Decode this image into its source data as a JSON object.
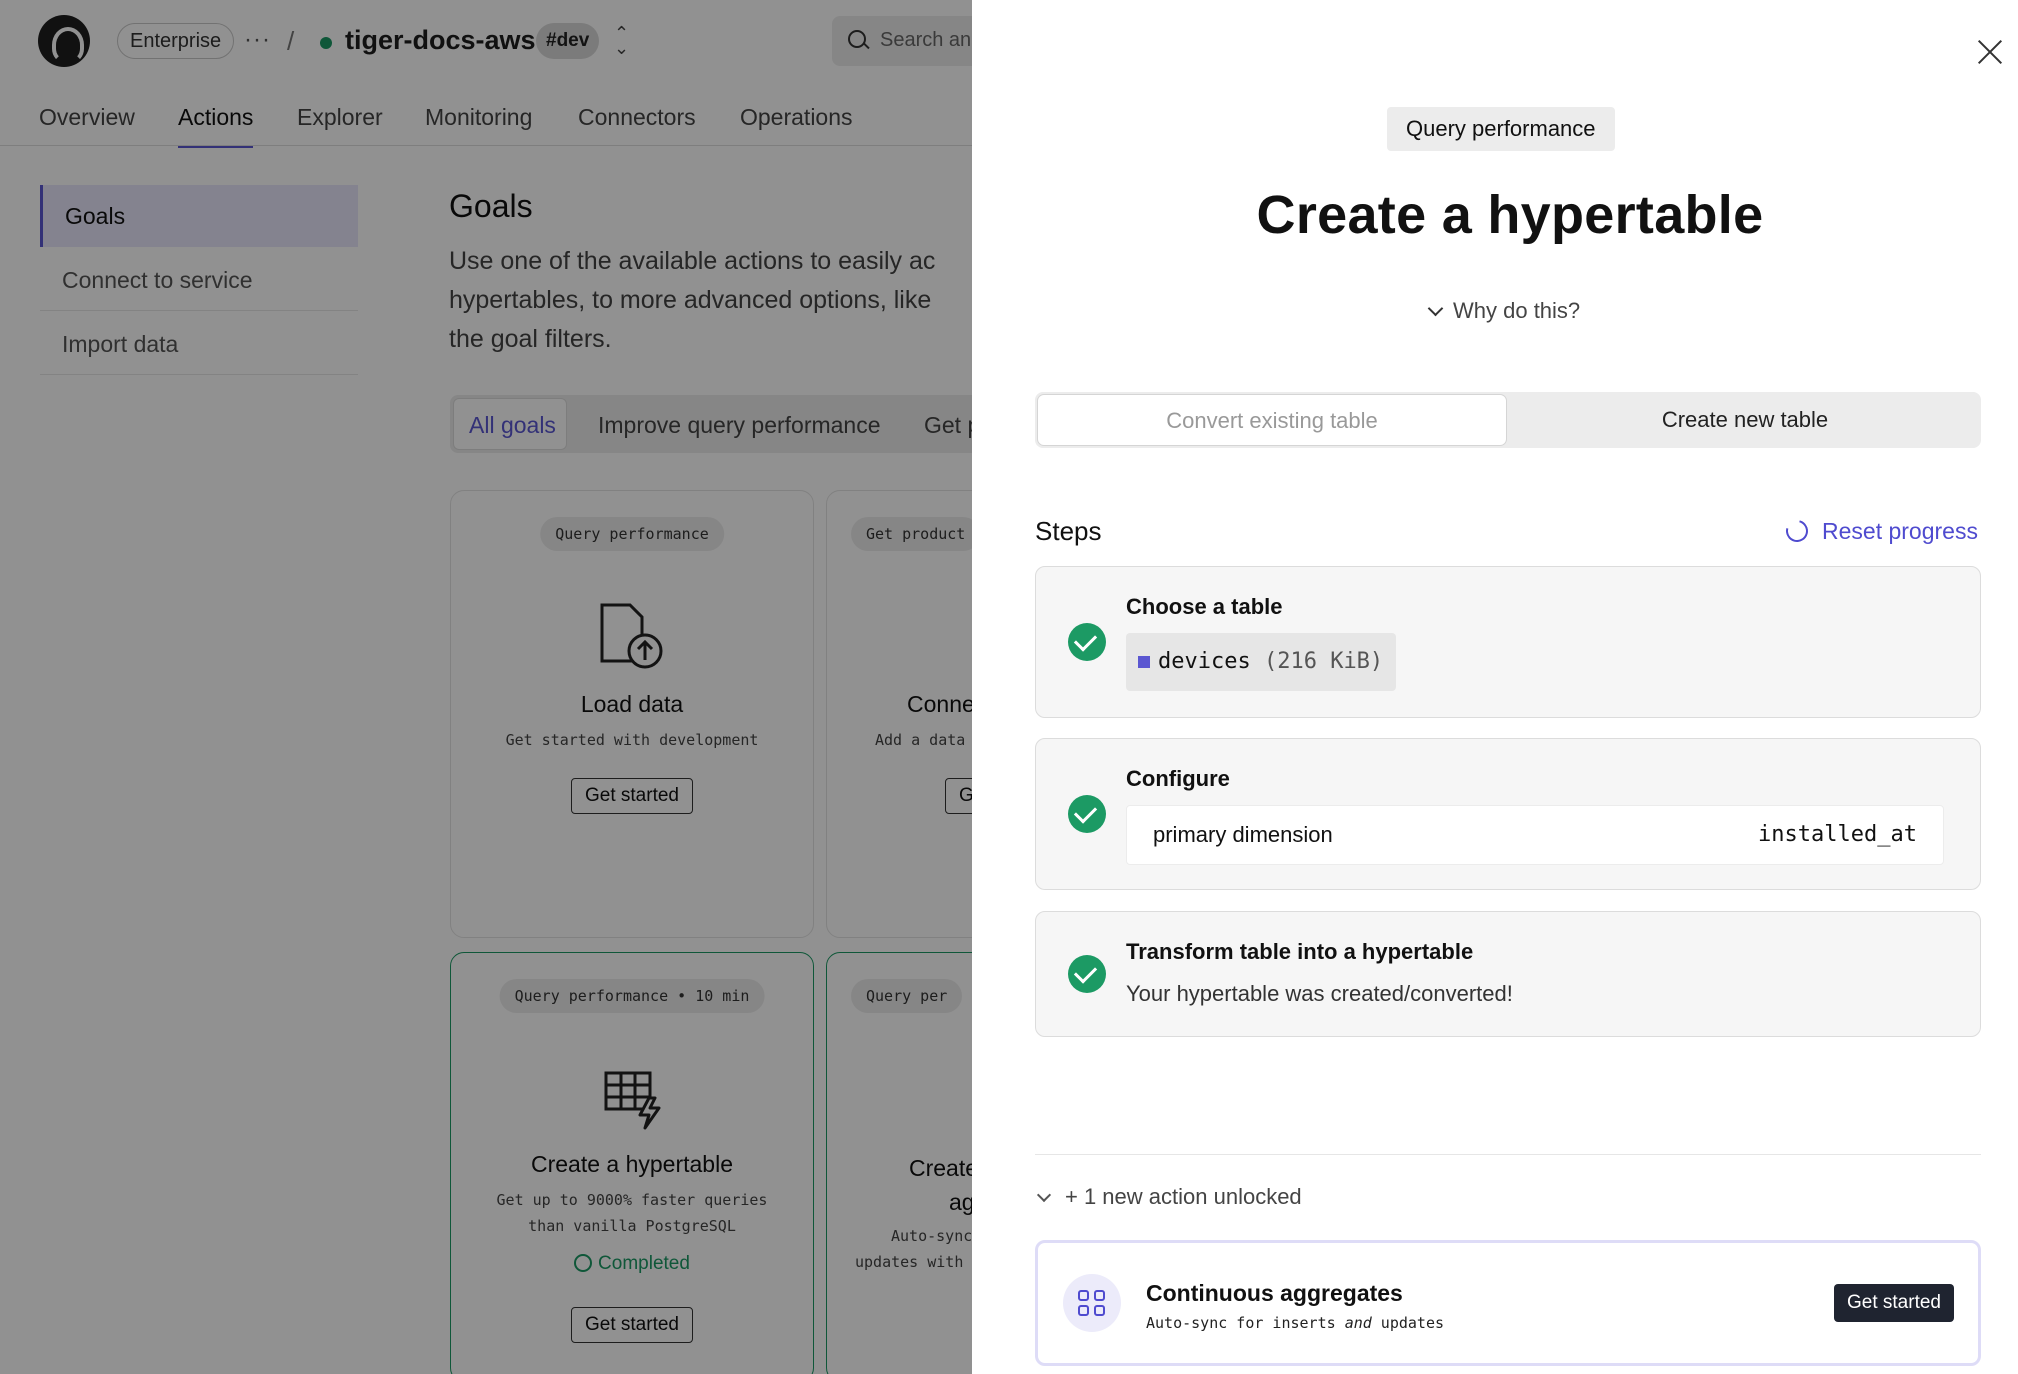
{
  "app": {
    "org_label": "Enterprise",
    "more_label": "···",
    "separator": "/",
    "project_name": "tiger-docs-aws",
    "env_badge": "#dev",
    "search_placeholder": "Search an",
    "tabs": [
      "Overview",
      "Actions",
      "Explorer",
      "Monitoring",
      "Connectors",
      "Operations"
    ],
    "active_tab": "Actions",
    "sidebar": [
      "Goals",
      "Connect to service",
      "Import data"
    ],
    "active_sidebar": "Goals",
    "goals": {
      "title": "Goals",
      "desc_lines": [
        "Use one of the available actions to easily ac",
        "hypertables, to more advanced options, like",
        "the goal filters."
      ]
    },
    "filters": [
      "All goals",
      "Improve query performance",
      "Get p"
    ],
    "cards": [
      {
        "chip": "Query performance",
        "title": "Load data",
        "desc": "Get started with development",
        "button": "Get started"
      },
      {
        "chip": "Get product",
        "title": "Conne",
        "desc": "Add a data",
        "button": "G"
      },
      {
        "chip": "Query performance • 10 min",
        "title": "Create a hypertable",
        "desc_lines": [
          "Get up to 9000% faster queries",
          "than vanilla PostgreSQL"
        ],
        "status": "Completed",
        "button": "Get started"
      },
      {
        "chip": "Query per",
        "title_lines": [
          "Create",
          "ag"
        ],
        "desc_lines": [
          "Auto-sync",
          "updates with"
        ]
      }
    ]
  },
  "panel": {
    "category_chip": "Query performance",
    "title": "Create a hypertable",
    "why_label": "Why do this?",
    "segments": [
      "Convert existing table",
      "Create new table"
    ],
    "selected_segment": "Convert existing table",
    "steps_heading": "Steps",
    "reset_label": "Reset progress",
    "steps": [
      {
        "title": "Choose a table",
        "table_name": "devices",
        "table_size": "(216 KiB)",
        "status": "done"
      },
      {
        "title": "Configure",
        "config_key": "primary dimension",
        "config_value": "installed_at",
        "status": "done"
      },
      {
        "title": "Transform table into a hypertable",
        "message": "Your hypertable was created/converted!",
        "status": "done"
      }
    ],
    "unlocked_label": "+ 1 new action unlocked",
    "unlocked_card": {
      "title": "Continuous aggregates",
      "subtitle_pre": "Auto-sync for inserts ",
      "subtitle_em": "and",
      "subtitle_post": " updates",
      "button": "Get started"
    }
  },
  "colors": {
    "accent": "#5b57d1",
    "success": "#1c9a64",
    "dark_button": "#1f2430"
  }
}
